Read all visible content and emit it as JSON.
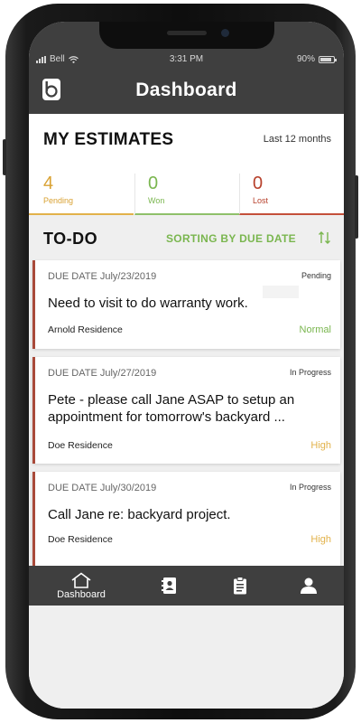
{
  "status_bar": {
    "carrier": "Bell",
    "time": "3:31 PM",
    "battery": "90%"
  },
  "header": {
    "title": "Dashboard"
  },
  "estimates": {
    "title": "MY ESTIMATES",
    "range": "Last 12 months",
    "stats": [
      {
        "count": "4",
        "label": "Pending",
        "color": "#d9a233"
      },
      {
        "count": "0",
        "label": "Won",
        "color": "#7ab64f"
      },
      {
        "count": "0",
        "label": "Lost",
        "color": "#b7402b"
      }
    ]
  },
  "todo": {
    "title": "TO-DO",
    "sort_label": "SORTING BY DUE DATE",
    "items": [
      {
        "due": "DUE DATE July/23/2019",
        "status": "Pending",
        "description": "Need to visit to do warranty work.",
        "location": "Arnold Residence",
        "priority": "Normal"
      },
      {
        "due": "DUE DATE July/27/2019",
        "status": "In Progress",
        "description": "Pete - please call Jane ASAP to setup an appointment for tomorrow's backyard ...",
        "location": "Doe Residence",
        "priority": "High"
      },
      {
        "due": "DUE DATE July/30/2019",
        "status": "In Progress",
        "description": "Call Jane re: backyard project.",
        "location": "Doe Residence",
        "priority": "High"
      }
    ]
  },
  "tabbar": {
    "items": [
      {
        "label": "Dashboard",
        "icon": "home-icon"
      },
      {
        "label": "",
        "icon": "contacts-icon"
      },
      {
        "label": "",
        "icon": "clipboard-icon"
      },
      {
        "label": "",
        "icon": "profile-icon"
      }
    ]
  },
  "colors": {
    "bar": "#3f3f3f",
    "accent_green": "#7ab64f",
    "accent_yellow": "#e2b24a",
    "accent_red": "#b7402b"
  }
}
